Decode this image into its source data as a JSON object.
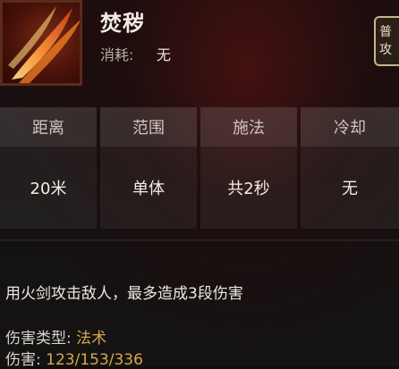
{
  "skill": {
    "name": "焚秽",
    "cost_label": "消耗:",
    "cost_value": "无",
    "tab_label_1": "普",
    "tab_label_2": "攻"
  },
  "stats": [
    {
      "label": "距离",
      "value": "20米"
    },
    {
      "label": "范围",
      "value": "单体"
    },
    {
      "label": "施法",
      "value": "共2秒"
    },
    {
      "label": "冷却",
      "value": "无"
    }
  ],
  "description": "用火剑攻击敌人，最多造成3段伤害",
  "damage_type": {
    "label": "伤害类型:",
    "value": "法术"
  },
  "damage": {
    "label": "伤害:",
    "value": "123/153/336"
  }
}
